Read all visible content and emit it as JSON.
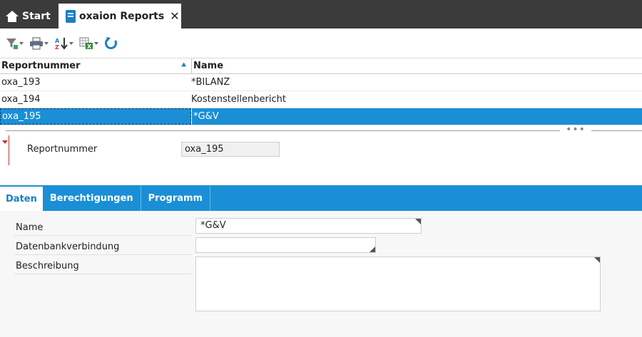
{
  "tabs": {
    "start": "Start",
    "reports": "oxaion Reports",
    "close": "✕"
  },
  "grid": {
    "headers": [
      "Reportnummer",
      "Name"
    ],
    "rows": [
      {
        "nr": "oxa_193",
        "name": "*BILANZ"
      },
      {
        "nr": "oxa_194",
        "name": "Kostenstellenbericht"
      },
      {
        "nr": "oxa_195",
        "name": "*G&V",
        "selected": true
      }
    ]
  },
  "splitter": {
    "dots": "•••"
  },
  "detail": {
    "label": "Reportnummer",
    "value": "oxa_195"
  },
  "tabstrip": {
    "tabs": [
      "Daten",
      "Berechtigungen",
      "Programm"
    ],
    "active": "Daten"
  },
  "form": {
    "name_label": "Name",
    "name_value": "*G&V",
    "db_label": "Datenbankverbindung",
    "db_value": "",
    "desc_label": "Beschreibung",
    "desc_value": ""
  },
  "colors": {
    "accent": "#1a8fd6",
    "tabbar": "#3b3b3b",
    "refresh": "#1a7fc2"
  }
}
